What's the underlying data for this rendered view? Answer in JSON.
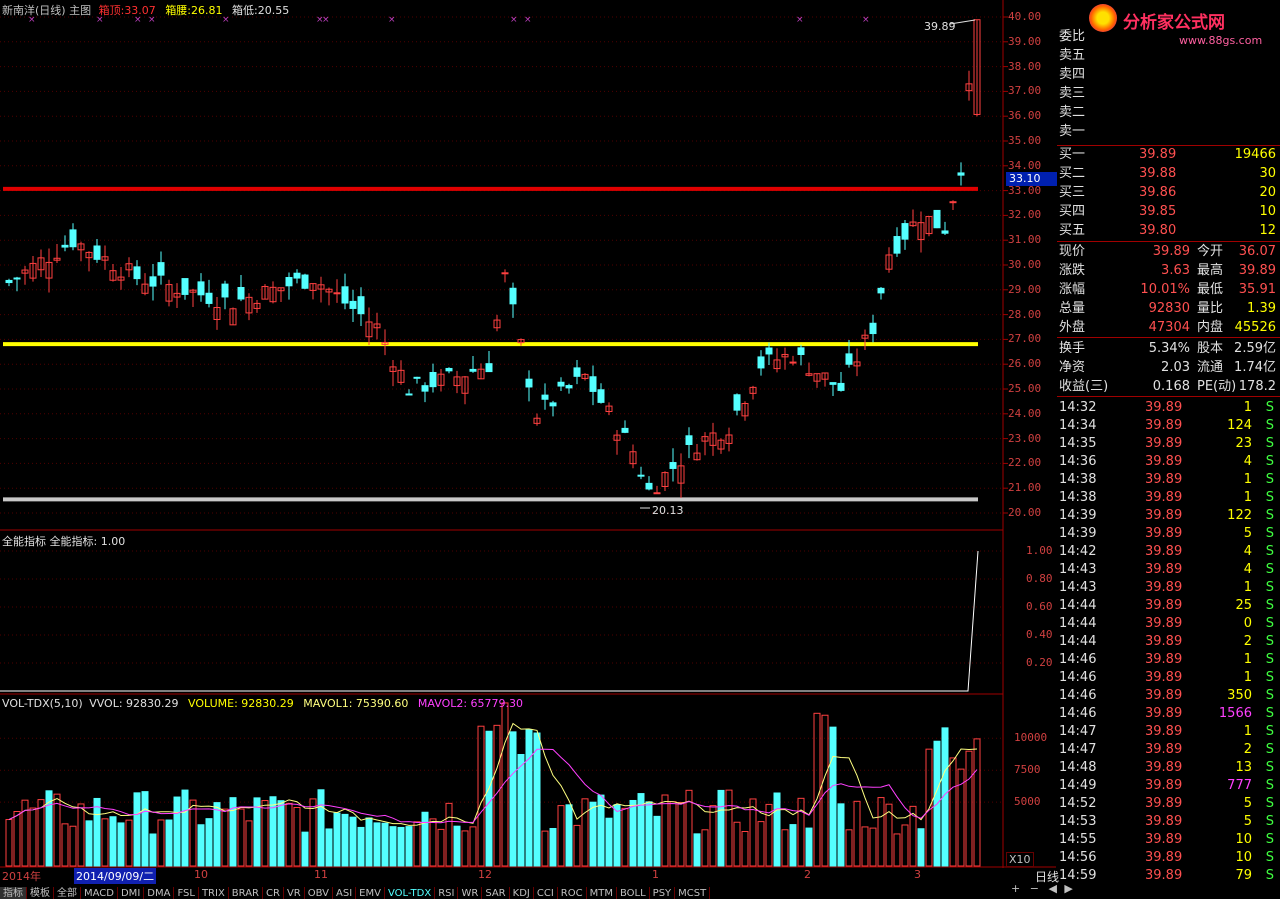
{
  "header": {
    "stock_name": "新南洋(日线) 主图",
    "box_top_label": "箱顶:",
    "box_top_value": "33.07",
    "box_mid_label": "箱腰:",
    "box_mid_value": "26.81",
    "box_low_label": "箱低:",
    "box_low_value": "20.55"
  },
  "price_axis": [
    "40.00",
    "39.00",
    "38.00",
    "37.00",
    "36.00",
    "35.00",
    "34.00",
    "33.00",
    "32.00",
    "31.00",
    "30.00",
    "29.00",
    "28.00",
    "27.00",
    "26.00",
    "25.00",
    "24.00",
    "23.00",
    "22.00",
    "21.00",
    "20.00"
  ],
  "annotations": {
    "high_mark": "39.89",
    "low_mark": "20.13",
    "current_tag": "33.10"
  },
  "indicator": {
    "title": "全能指标  全能指标: 1.00",
    "axis": [
      "1.00",
      "0.80",
      "0.60",
      "0.40",
      "0.20"
    ]
  },
  "volume": {
    "title": "VOL-TDX(5,10)",
    "vvol": "VVOL: 92830.29",
    "volume": "VOLUME: 92830.29",
    "mavol1": "MAVOL1: 75390.60",
    "mavol2": "MAVOL2: 65779.30",
    "axis": [
      "10000",
      "7500",
      "5000"
    ],
    "unit": "X10"
  },
  "dates": {
    "year": "2014年",
    "selected": "2014/09/09/二",
    "months": [
      "10",
      "11",
      "12",
      "1",
      "2",
      "3"
    ]
  },
  "tabs": [
    "指标",
    "模板",
    "全部",
    "MACD",
    "DMI",
    "DMA",
    "FSL",
    "TRIX",
    "BRAR",
    "CR",
    "VR",
    "OBV",
    "ASI",
    "EMV",
    "VOL-TDX",
    "RSI",
    "WR",
    "SAR",
    "KDJ",
    "CCI",
    "ROC",
    "MTM",
    "BOLL",
    "PSY",
    "MCST"
  ],
  "panel": {
    "brand": "分析家公式网",
    "brand_url": "www.88gs.com",
    "sell_side": [
      "委比",
      "卖五",
      "卖四",
      "卖三",
      "卖二",
      "卖一"
    ],
    "buy_side": [
      {
        "label": "买一",
        "price": "39.89",
        "vol": "19466"
      },
      {
        "label": "买二",
        "price": "39.88",
        "vol": "30"
      },
      {
        "label": "买三",
        "price": "39.86",
        "vol": "20"
      },
      {
        "label": "买四",
        "price": "39.85",
        "vol": "10"
      },
      {
        "label": "买五",
        "price": "39.80",
        "vol": "12"
      }
    ],
    "quote": [
      {
        "l1": "现价",
        "v1": "39.89",
        "l2": "今开",
        "v2": "36.07"
      },
      {
        "l1": "涨跌",
        "v1": "3.63",
        "l2": "最高",
        "v2": "39.89"
      },
      {
        "l1": "涨幅",
        "v1": "10.01%",
        "l2": "最低",
        "v2": "35.91"
      },
      {
        "l1": "总量",
        "v1": "92830",
        "l2": "量比",
        "v2": "1.39"
      },
      {
        "l1": "外盘",
        "v1": "47304",
        "l2": "内盘",
        "v2": "45526"
      }
    ],
    "finance": [
      {
        "l1": "换手",
        "v1": "5.34%",
        "l2": "股本",
        "v2": "2.59亿"
      },
      {
        "l1": "净资",
        "v1": "2.03",
        "l2": "流通",
        "v2": "1.74亿"
      },
      {
        "l1": "收益(三)",
        "v1": "0.168",
        "l2": "PE(动)",
        "v2": "178.2"
      }
    ],
    "ticks": [
      {
        "t": "14:32",
        "p": "39.89",
        "v": "1",
        "s": "S"
      },
      {
        "t": "14:34",
        "p": "39.89",
        "v": "124",
        "s": "S"
      },
      {
        "t": "14:35",
        "p": "39.89",
        "v": "23",
        "s": "S"
      },
      {
        "t": "14:36",
        "p": "39.89",
        "v": "4",
        "s": "S"
      },
      {
        "t": "14:38",
        "p": "39.89",
        "v": "1",
        "s": "S"
      },
      {
        "t": "14:38",
        "p": "39.89",
        "v": "1",
        "s": "S"
      },
      {
        "t": "14:39",
        "p": "39.89",
        "v": "122",
        "s": "S"
      },
      {
        "t": "14:39",
        "p": "39.89",
        "v": "5",
        "s": "S"
      },
      {
        "t": "14:42",
        "p": "39.89",
        "v": "4",
        "s": "S"
      },
      {
        "t": "14:43",
        "p": "39.89",
        "v": "4",
        "s": "S"
      },
      {
        "t": "14:43",
        "p": "39.89",
        "v": "1",
        "s": "S"
      },
      {
        "t": "14:44",
        "p": "39.89",
        "v": "25",
        "s": "S"
      },
      {
        "t": "14:44",
        "p": "39.89",
        "v": "0",
        "s": "S"
      },
      {
        "t": "14:44",
        "p": "39.89",
        "v": "2",
        "s": "S"
      },
      {
        "t": "14:46",
        "p": "39.89",
        "v": "1",
        "s": "S"
      },
      {
        "t": "14:46",
        "p": "39.89",
        "v": "1",
        "s": "S"
      },
      {
        "t": "14:46",
        "p": "39.89",
        "v": "350",
        "s": "S"
      },
      {
        "t": "14:46",
        "p": "39.89",
        "v": "1566",
        "s": "S"
      },
      {
        "t": "14:47",
        "p": "39.89",
        "v": "1",
        "s": "S"
      },
      {
        "t": "14:47",
        "p": "39.89",
        "v": "2",
        "s": "S"
      },
      {
        "t": "14:48",
        "p": "39.89",
        "v": "13",
        "s": "S"
      },
      {
        "t": "14:49",
        "p": "39.89",
        "v": "777",
        "s": "S"
      },
      {
        "t": "14:52",
        "p": "39.89",
        "v": "5",
        "s": "S"
      },
      {
        "t": "14:53",
        "p": "39.89",
        "v": "5",
        "s": "S"
      },
      {
        "t": "14:55",
        "p": "39.89",
        "v": "10",
        "s": "S"
      },
      {
        "t": "14:56",
        "p": "39.89",
        "v": "10",
        "s": "S"
      },
      {
        "t": "14:59",
        "p": "39.89",
        "v": "79",
        "s": "S"
      }
    ],
    "period": "日线"
  },
  "colors": {
    "up": "#ff4040",
    "down": "#54ffff",
    "box_top": "#e00000",
    "box_mid": "#ffff00",
    "box_low": "#c8c8c8",
    "ma1": "#ffff80",
    "ma2": "#ff40ff",
    "price_text": "#ff5050",
    "vol_text": "#ffff00"
  }
}
